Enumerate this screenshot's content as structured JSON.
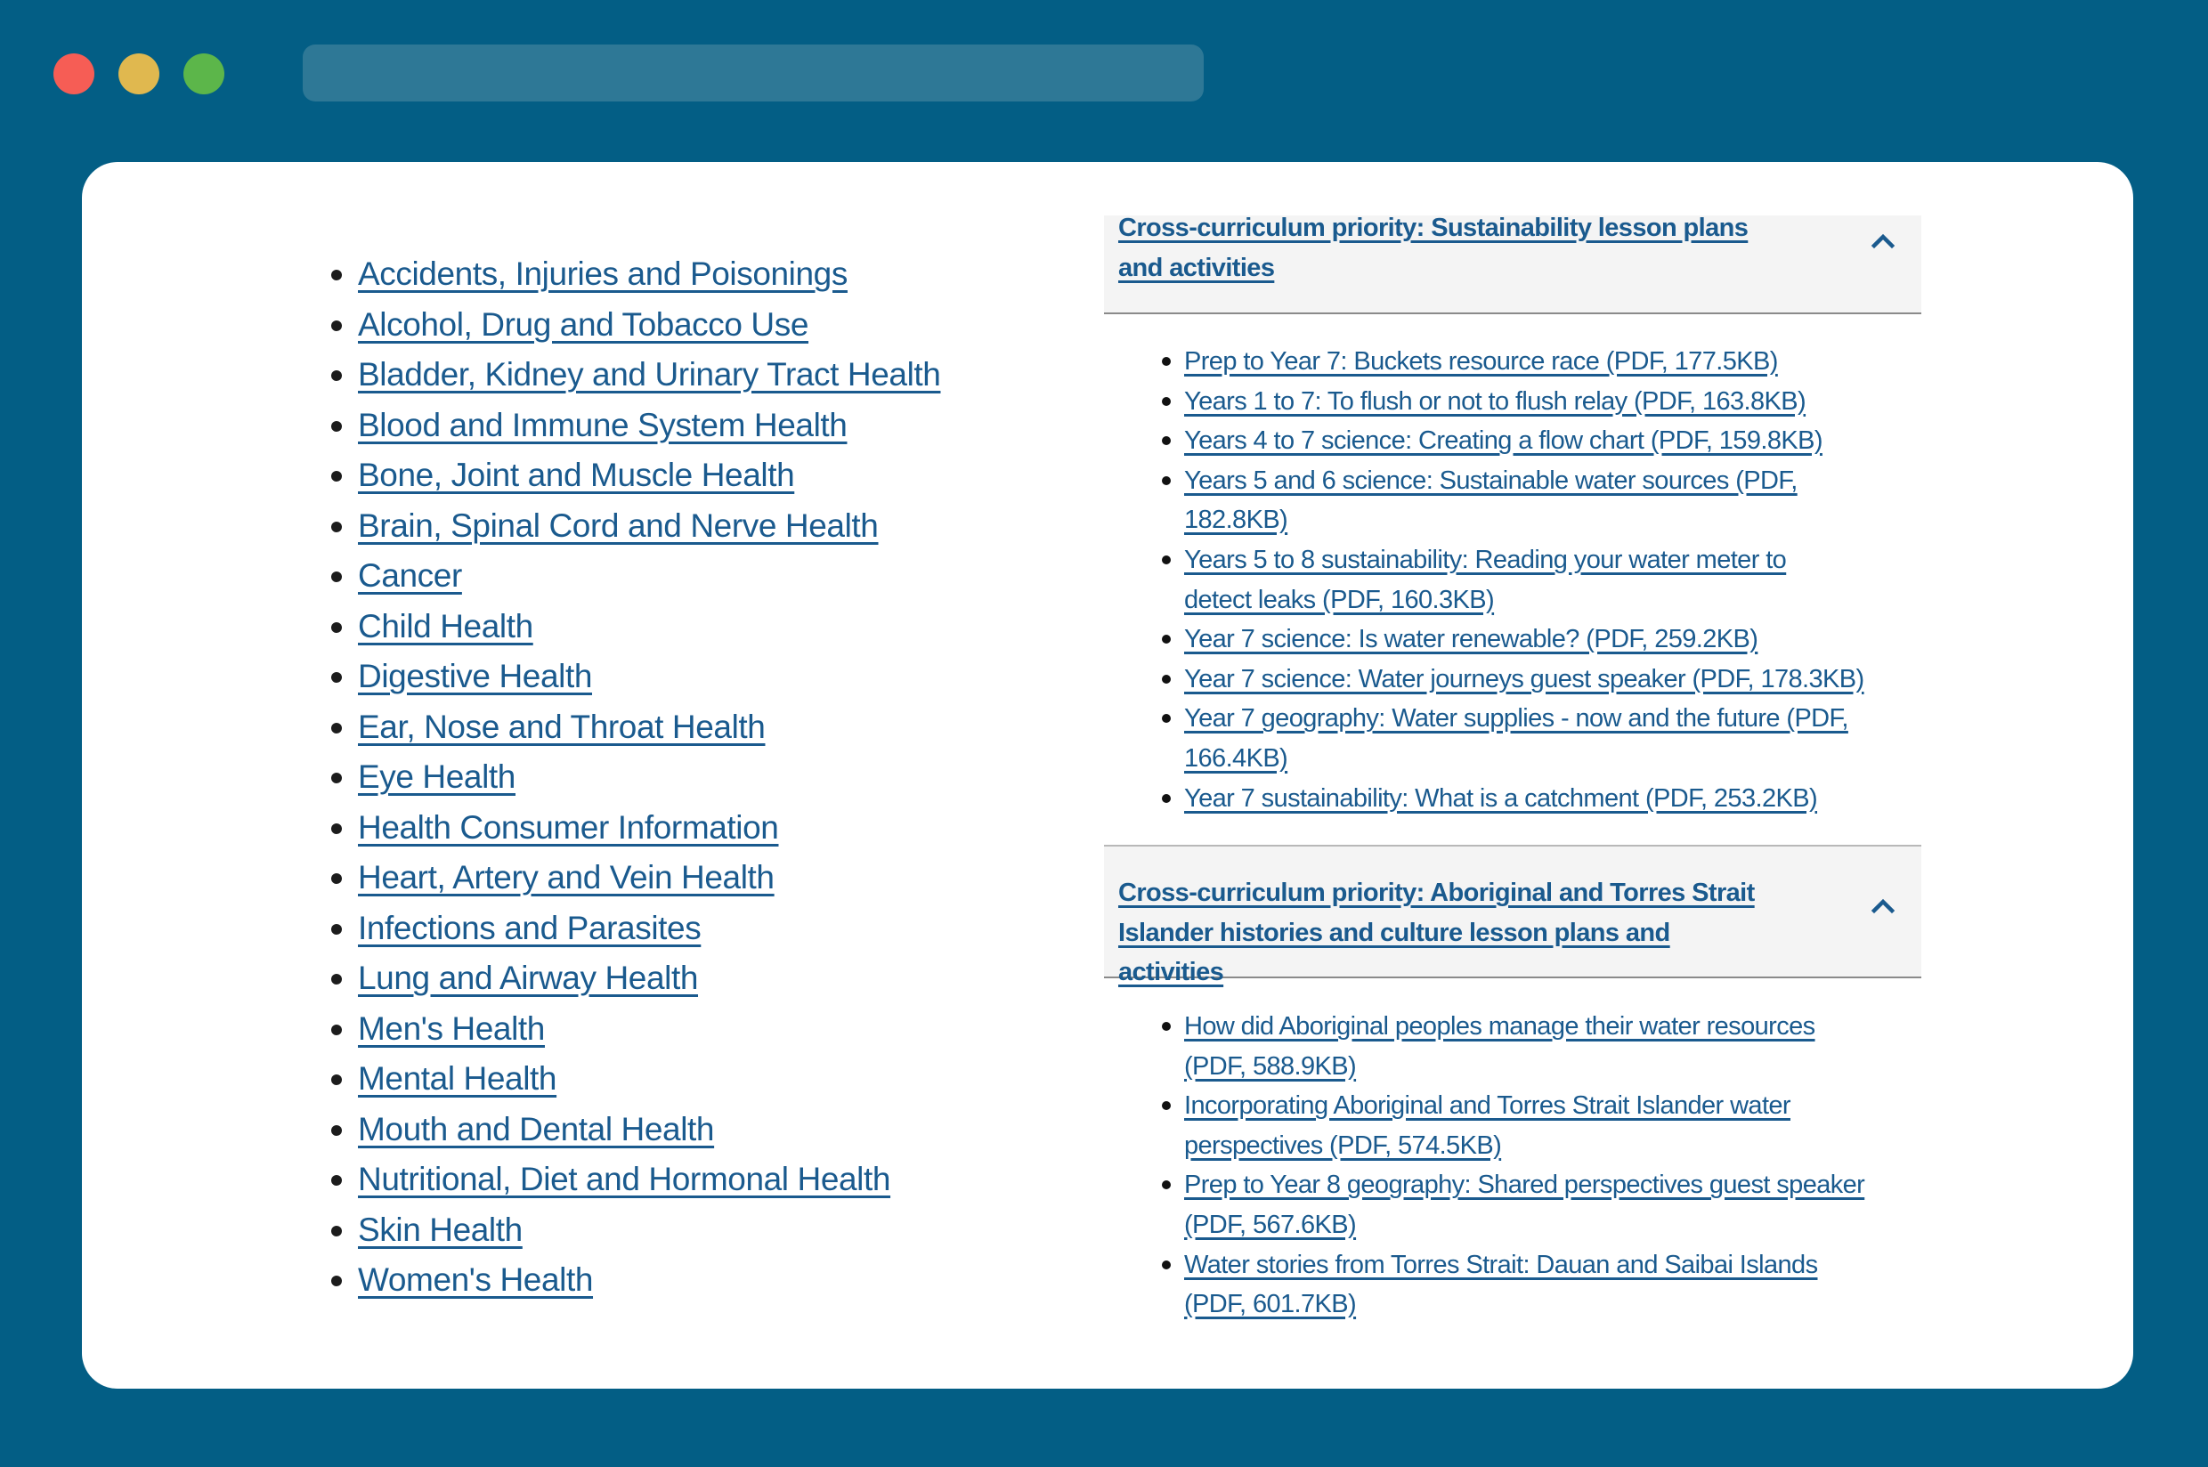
{
  "window": {
    "controls": [
      "close",
      "minimize",
      "maximize"
    ],
    "url": ""
  },
  "topics": {
    "items": [
      {
        "label": "Accidents, Injuries and Poisonings"
      },
      {
        "label": "Alcohol, Drug and Tobacco Use"
      },
      {
        "label": "Bladder, Kidney and Urinary Tract Health"
      },
      {
        "label": "Blood and Immune System Health"
      },
      {
        "label": "Bone, Joint and Muscle Health"
      },
      {
        "label": "Brain, Spinal Cord and Nerve Health"
      },
      {
        "label": "Cancer"
      },
      {
        "label": "Child Health"
      },
      {
        "label": "Digestive Health"
      },
      {
        "label": "Ear, Nose and Throat Health"
      },
      {
        "label": "Eye Health"
      },
      {
        "label": "Health Consumer Information"
      },
      {
        "label": "Heart, Artery and Vein Health"
      },
      {
        "label": "Infections and Parasites"
      },
      {
        "label": "Lung and Airway Health"
      },
      {
        "label": "Men's Health"
      },
      {
        "label": "Mental Health"
      },
      {
        "label": "Mouth and Dental Health"
      },
      {
        "label": "Nutritional, Diet and Hormonal Health"
      },
      {
        "label": "Skin Health"
      },
      {
        "label": "Women's Health"
      }
    ]
  },
  "accordions": [
    {
      "title": "Cross-curriculum priority: Sustainability lesson plans and activities",
      "expanded": true,
      "icon": "chevron-up-icon",
      "items": [
        {
          "label": "Prep to Year 7: Buckets resource race (PDF, 177.5KB)"
        },
        {
          "label": "Years 1 to 7: To flush or not to flush relay (PDF, 163.8KB)"
        },
        {
          "label": "Years 4 to 7 science: Creating a flow chart (PDF, 159.8KB)"
        },
        {
          "label": "Years 5 and 6 science: Sustainable water sources (PDF, 182.8KB)"
        },
        {
          "label": "Years 5 to 8 sustainability: Reading your water meter to detect leaks (PDF, 160.3KB)"
        },
        {
          "label": "Year 7 science: Is water renewable? (PDF, 259.2KB)"
        },
        {
          "label": "Year 7 science: Water journeys guest speaker (PDF, 178.3KB)"
        },
        {
          "label": "Year 7 geography: Water supplies - now and the future (PDF, 166.4KB)"
        },
        {
          "label": "Year 7 sustainability: What is a catchment (PDF, 253.2KB)"
        }
      ]
    },
    {
      "title": "Cross-curriculum priority: Aboriginal and Torres Strait Islander histories and culture lesson plans and activities",
      "expanded": true,
      "icon": "chevron-up-icon",
      "items": [
        {
          "label": "How did Aboriginal peoples manage their water resources (PDF, 588.9KB)"
        },
        {
          "label": "Incorporating Aboriginal and Torres Strait Islander water perspectives (PDF, 574.5KB)"
        },
        {
          "label": "Prep to Year 8 geography: Shared perspectives guest speaker (PDF, 567.6KB)"
        },
        {
          "label": "Water stories from Torres Strait: Dauan and Saibai Islands (PDF, 601.7KB)"
        }
      ]
    }
  ],
  "colors": {
    "background": "#035e85",
    "link": "#1a5a8e",
    "accordion_header_bg": "#f4f4f4",
    "close": "#f65d55",
    "minimize": "#e0b84f",
    "maximize": "#5cb64a"
  }
}
